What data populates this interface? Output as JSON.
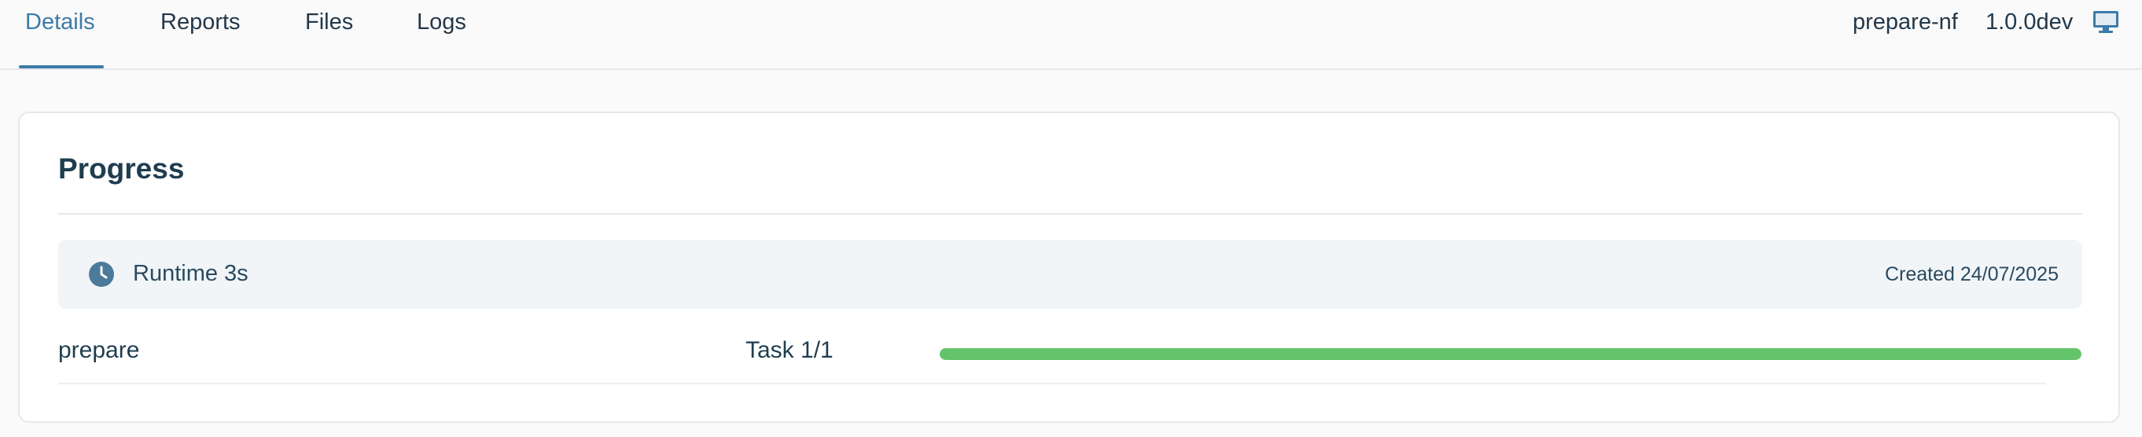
{
  "tabs": [
    {
      "label": "Details",
      "active": true
    },
    {
      "label": "Reports",
      "active": false
    },
    {
      "label": "Files",
      "active": false
    },
    {
      "label": "Logs",
      "active": false
    }
  ],
  "pipeline": {
    "name": "prepare-nf",
    "version": "1.0.0dev",
    "icon": "monitor-icon"
  },
  "progress_card": {
    "title": "Progress",
    "runtime": "Runtime 3s",
    "runtime_icon": "clock-icon",
    "created": "Created 24/07/2025",
    "tasks": [
      {
        "name": "prepare",
        "count": "Task 1/1",
        "progress": 1.0,
        "color": "#63c46a"
      }
    ]
  },
  "colors": {
    "accent": "#3c7ba8",
    "progress_complete": "#63c46a",
    "text_dark": "#1f3d4f"
  }
}
